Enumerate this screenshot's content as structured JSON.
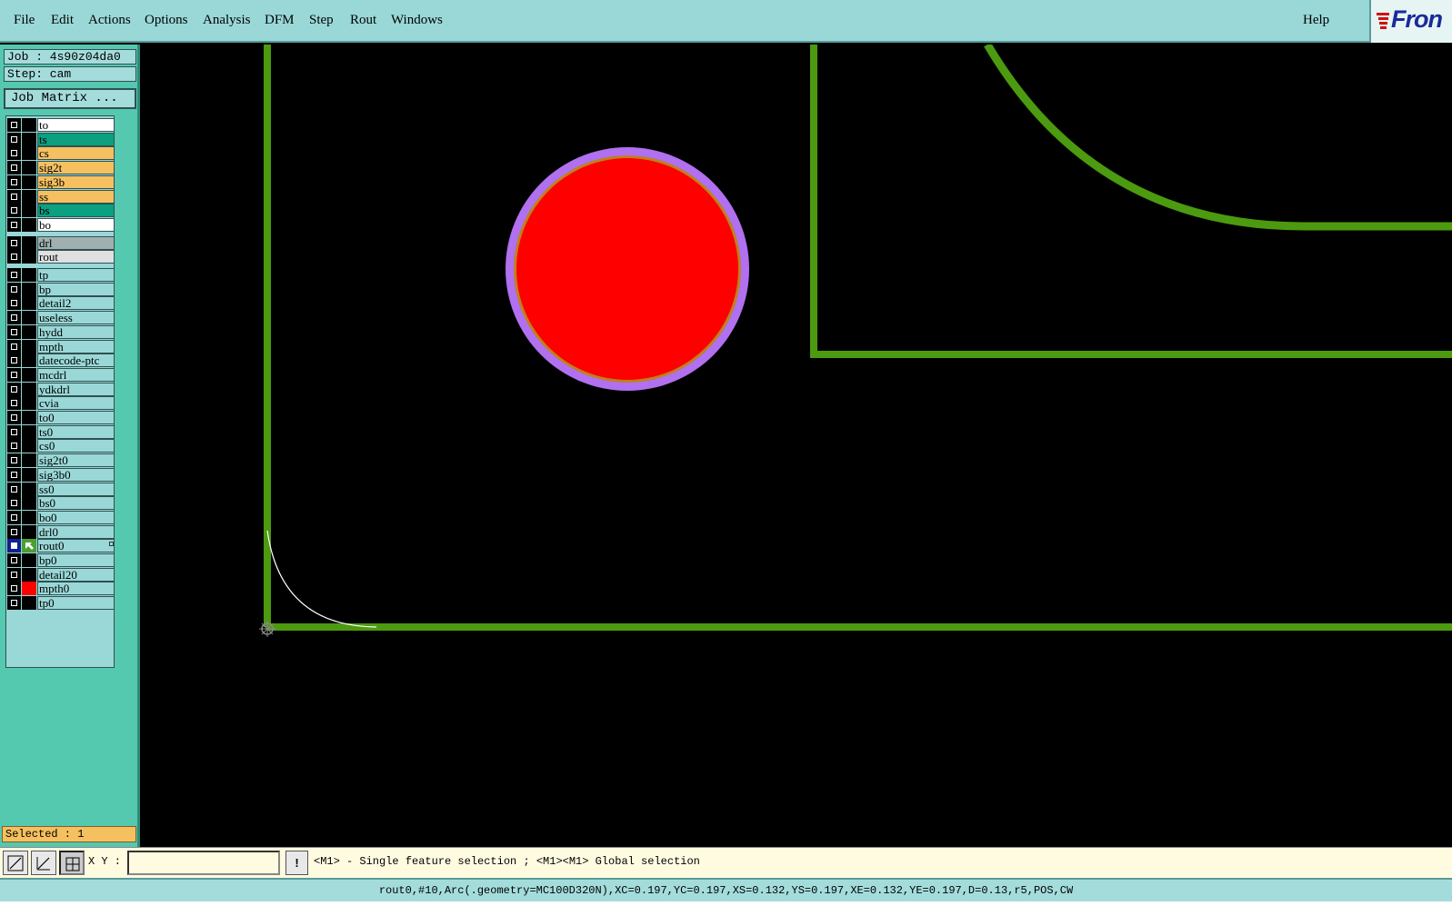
{
  "menu": {
    "file": "File",
    "edit": "Edit",
    "actions": "Actions",
    "options": "Options",
    "analysis": "Analysis",
    "dfm": "DFM",
    "step": "Step",
    "rout": "Rout",
    "windows": "Windows",
    "help": "Help"
  },
  "logo_text": "Fron",
  "job_label": "Job : 4s90z04da0",
  "step_label": "Step: cam",
  "job_matrix_label": "Job Matrix ...",
  "layers": [
    {
      "name": "to",
      "color": "#ffffff"
    },
    {
      "name": "ts",
      "color": "#0aa080"
    },
    {
      "name": "cs",
      "color": "#f5c060"
    },
    {
      "name": "sig2t",
      "color": "#f5c060"
    },
    {
      "name": "sig3b",
      "color": "#f5c060"
    },
    {
      "name": "ss",
      "color": "#f5c060"
    },
    {
      "name": "bs",
      "color": "#0aa080"
    },
    {
      "name": "bo",
      "color": "#ffffff"
    },
    {
      "name": "drl",
      "color": "#a0b0b0"
    },
    {
      "name": "rout",
      "color": "#e0e0e0"
    },
    {
      "name": "tp",
      "color": "#9ad8d8"
    },
    {
      "name": "bp",
      "color": "#9ad8d8"
    },
    {
      "name": "detail2",
      "color": "#9ad8d8"
    },
    {
      "name": "useless",
      "color": "#9ad8d8"
    },
    {
      "name": "hydd",
      "color": "#9ad8d8"
    },
    {
      "name": "mpth",
      "color": "#9ad8d8"
    },
    {
      "name": "datecode-ptc",
      "color": "#9ad8d8"
    },
    {
      "name": "mcdrl",
      "color": "#9ad8d8"
    },
    {
      "name": "ydkdrl",
      "color": "#9ad8d8"
    },
    {
      "name": "cvia",
      "color": "#9ad8d8"
    },
    {
      "name": "to0",
      "color": "#9ad8d8"
    },
    {
      "name": "ts0",
      "color": "#9ad8d8"
    },
    {
      "name": "cs0",
      "color": "#9ad8d8"
    },
    {
      "name": "sig2t0",
      "color": "#9ad8d8"
    },
    {
      "name": "sig3b0",
      "color": "#9ad8d8"
    },
    {
      "name": "ss0",
      "color": "#9ad8d8"
    },
    {
      "name": "bs0",
      "color": "#9ad8d8"
    },
    {
      "name": "bo0",
      "color": "#9ad8d8"
    },
    {
      "name": "drl0",
      "color": "#9ad8d8"
    },
    {
      "name": "rout0",
      "color": "#9ad8d8",
      "active": true,
      "swatch": "#4aa030"
    },
    {
      "name": "bp0",
      "color": "#9ad8d8"
    },
    {
      "name": "detail20",
      "color": "#9ad8d8"
    },
    {
      "name": "mpth0",
      "color": "#9ad8d8",
      "swatch": "#ff0000"
    },
    {
      "name": "tp0",
      "color": "#9ad8d8"
    }
  ],
  "selected_label": "Selected : 1",
  "xy_label": "X Y :",
  "xy_input_value": "",
  "exclaim_label": "!",
  "prompt_text": "<M1> - Single feature selection ; <M1><M1> Global selection",
  "status_text": "rout0,#10,Arc(.geometry=MC100D320N),XC=0.197,YC=0.197,XS=0.132,YS=0.197,XE=0.132,YE=0.197,D=0.13,r5,POS,CW",
  "colors": {
    "rout_line": "#4c9a10",
    "pad_fill": "#ff0000",
    "pad_ring": "#b070f0",
    "pad_inner_ring": "#c08020",
    "selection_arc": "#ffffff",
    "menubar": "#9ad8d8",
    "panel": "#55c8b0"
  }
}
